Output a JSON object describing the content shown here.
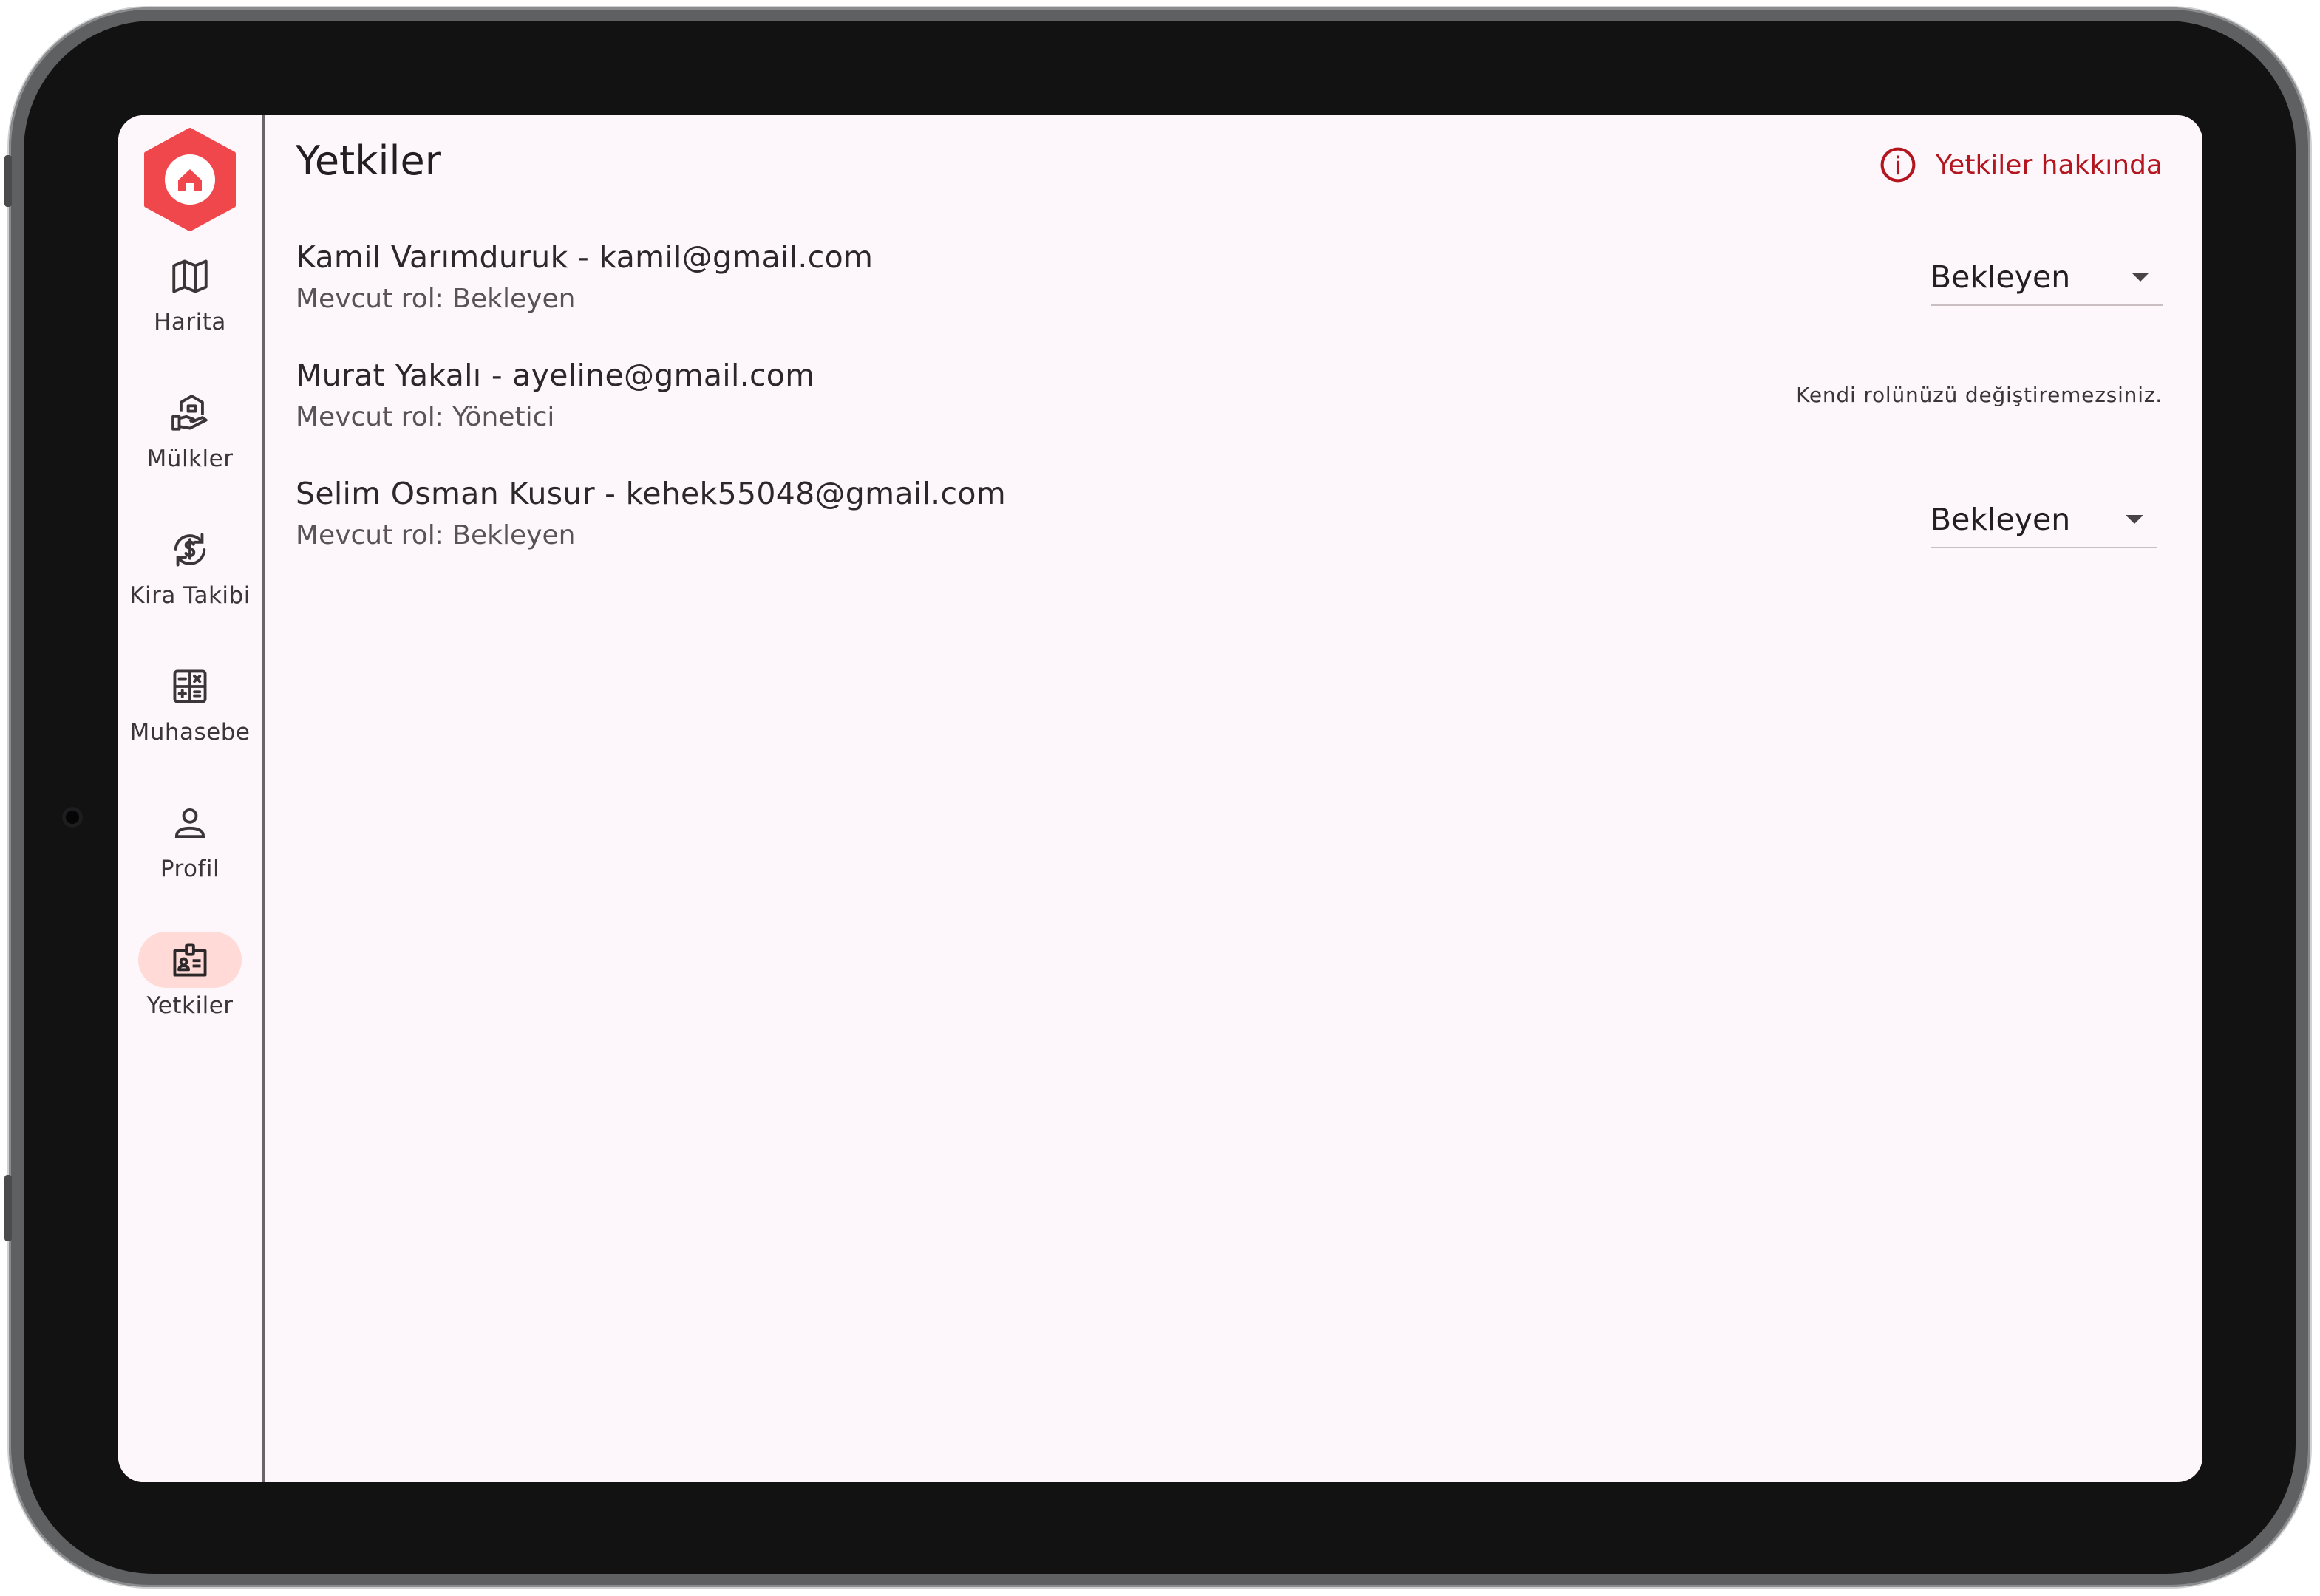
{
  "app": {
    "accent_color": "#f0474c",
    "link_color": "#b3161f",
    "active_pill_color": "#ffdad7"
  },
  "sidebar": {
    "logo_icon": "home-hexagon-logo",
    "items": [
      {
        "label": "Harita",
        "icon": "map-icon",
        "active": false
      },
      {
        "label": "Mülkler",
        "icon": "property-hand-icon",
        "active": false
      },
      {
        "label": "Kira Takibi",
        "icon": "rent-cycle-dollar-icon",
        "active": false
      },
      {
        "label": "Muhasebe",
        "icon": "calculator-icon",
        "active": false
      },
      {
        "label": "Profil",
        "icon": "person-icon",
        "active": false
      },
      {
        "label": "Yetkiler",
        "icon": "id-badge-icon",
        "active": true
      }
    ]
  },
  "header": {
    "title": "Yetkiler",
    "about_link": "Yetkiler hakkında",
    "about_icon": "info-icon"
  },
  "users": [
    {
      "name_email": "Kamil Varımduruk - kamil@gmail.com",
      "current_role": "Mevcut rol: Bekleyen",
      "select_value": "Bekleyen"
    },
    {
      "name_email": "Murat Yakalı - ayeline@gmail.com",
      "current_role": "Mevcut rol: Yönetici",
      "note": "Kendi rolünüzü değiştiremezsiniz."
    },
    {
      "name_email": "Selim Osman Kusur - kehek55048@gmail.com",
      "current_role": "Mevcut rol: Bekleyen",
      "select_value": "Bekleyen"
    }
  ]
}
